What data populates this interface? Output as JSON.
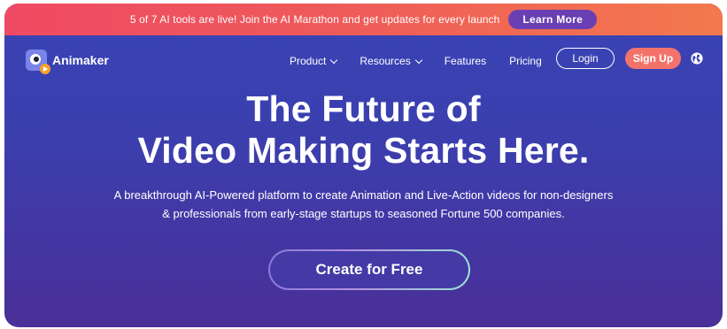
{
  "announcement": {
    "text": "5 of 7 AI tools are live! Join the AI Marathon and get updates for every launch",
    "button_label": "Learn More"
  },
  "nav": {
    "brand": "Animaker",
    "items": [
      {
        "label": "Product",
        "has_dropdown": true
      },
      {
        "label": "Resources",
        "has_dropdown": true
      },
      {
        "label": "Features",
        "has_dropdown": false
      },
      {
        "label": "Pricing",
        "has_dropdown": false
      }
    ],
    "login_label": "Login",
    "signup_label": "Sign Up",
    "language_icon": "globe-icon"
  },
  "hero": {
    "title_line1": "The Future of",
    "title_line2": "Video Making Starts Here.",
    "subtitle_line1": "A breakthrough AI-Powered platform to create Animation and Live-Action videos for non-designers",
    "subtitle_line2": "& professionals from early-stage startups to seasoned Fortune 500 companies.",
    "cta_label": "Create for Free"
  },
  "colors": {
    "announcement_bg": "#ef4a63",
    "hero_bg": "#3a44b6",
    "signup_bg": "#f3736b",
    "learn_more_bg": "#6a3fb4"
  }
}
